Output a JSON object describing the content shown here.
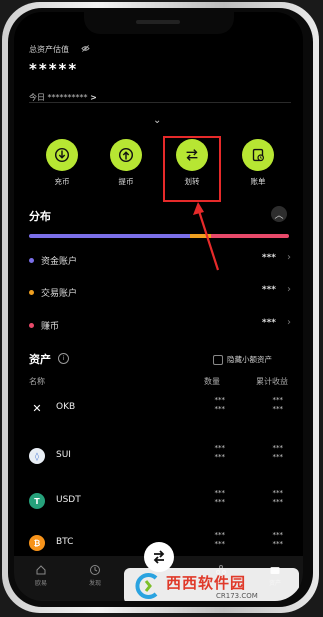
{
  "header": {
    "title": "总资产估值",
    "masked_value": "*****",
    "today_label": "今日",
    "today_value": "**********",
    "today_chevron": ">"
  },
  "actions": [
    {
      "label": "充币",
      "icon": "deposit-icon"
    },
    {
      "label": "提币",
      "icon": "withdraw-icon"
    },
    {
      "label": "划转",
      "icon": "transfer-icon"
    },
    {
      "label": "账单",
      "icon": "bill-icon"
    }
  ],
  "distribution": {
    "title": "分布",
    "bar_segments": [
      {
        "color": "#7b6fe8",
        "fraction": 0.62
      },
      {
        "color": "#f0a020",
        "fraction": 0.08
      },
      {
        "color": "#e84a6a",
        "fraction": 0.3
      }
    ],
    "rows": [
      {
        "label": "资金账户",
        "value": "***",
        "color": "#7b6fe8"
      },
      {
        "label": "交易账户",
        "value": "***",
        "color": "#f0a020"
      },
      {
        "label": "赚币",
        "value": "***",
        "color": "#e84a6a"
      }
    ]
  },
  "assets": {
    "title": "资产",
    "hide_small_label": "隐藏小额资产",
    "col_name": "名称",
    "col_qty": "数量",
    "col_pnl": "累计收益",
    "coins": [
      {
        "name": "OKB",
        "qty": "***",
        "qty2": "***",
        "pnl": "***",
        "pnl2": "***",
        "color": "#000",
        "fg": "#fff",
        "glyph": "✕"
      },
      {
        "name": "SUI",
        "qty": "***",
        "qty2": "***",
        "pnl": "***",
        "pnl2": "***",
        "color": "#e8eef5",
        "fg": "#4b7bd6",
        "glyph": "◊"
      },
      {
        "name": "USDT",
        "qty": "***",
        "qty2": "***",
        "pnl": "***",
        "pnl2": "***",
        "color": "#26a17b",
        "fg": "#fff",
        "glyph": "T"
      },
      {
        "name": "BTC",
        "qty": "***",
        "qty2": "***",
        "pnl": "***",
        "pnl2": "***",
        "color": "#f7931a",
        "fg": "#fff",
        "glyph": "₿"
      }
    ]
  },
  "nav": {
    "items": [
      {
        "label": "欧易"
      },
      {
        "label": "发现"
      },
      {
        "label": ""
      },
      {
        "label": ""
      },
      {
        "label": "资产"
      }
    ]
  },
  "watermark": {
    "text": "西西软件园",
    "subtext": "CR173.COM"
  },
  "colors": {
    "accent": "#b7e633",
    "highlight": "#e62a2a"
  }
}
